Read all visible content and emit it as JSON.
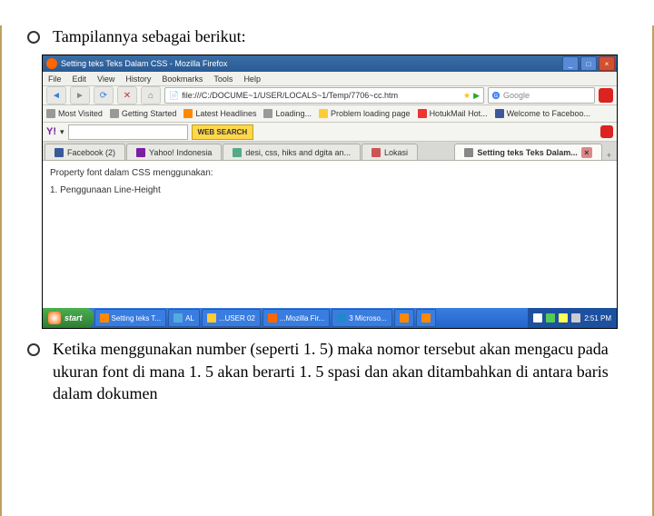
{
  "bullets": {
    "intro": "Tampilannya sebagai berikut:",
    "outro": "Ketika menggunakan number (seperti 1. 5) maka nomor tersebut akan mengacu pada ukuran font di mana 1. 5 akan berarti 1. 5 spasi dan akan ditambahkan di antara baris dalam dokumen"
  },
  "window": {
    "title": "Setting teks Teks Dalam CSS - Mozilla Firefox",
    "menu": [
      "File",
      "Edit",
      "View",
      "History",
      "Bookmarks",
      "Tools",
      "Help"
    ],
    "address": "file:///C:/DOCUME~1/USER/LOCALS~1/Temp/7706~cc.htm",
    "search_placeholder": "Google",
    "bookmarks": [
      "Most Visited",
      "Getting Started",
      "Latest Headlines",
      "Loading...",
      "Problem loading page",
      "HotukMail Hot...",
      "Welcome to Faceboo..."
    ],
    "yahoo_btn": "WEB SEARCH",
    "tabs": [
      {
        "label": "Facebook (2)",
        "ico": "fb"
      },
      {
        "label": "Yahoo! Indonesia",
        "ico": "yi"
      },
      {
        "label": "desi, css, hiks and dgita an...",
        "ico": "de"
      },
      {
        "label": "Lokasi",
        "ico": "lk"
      },
      {
        "label": "Setting teks Teks Dalam...",
        "ico": "st",
        "active": true
      }
    ],
    "page": {
      "line1": "Property font dalam CSS menggunakan:",
      "line2": "1. Penggunaan Line-Height"
    },
    "taskbar": {
      "start": "start",
      "items": [
        "Setting teks T...",
        "AL",
        "...USER 02",
        "...Mozilla Fir...",
        "3 Microso...",
        "...",
        "..."
      ],
      "clock": "2:51 PM"
    }
  }
}
